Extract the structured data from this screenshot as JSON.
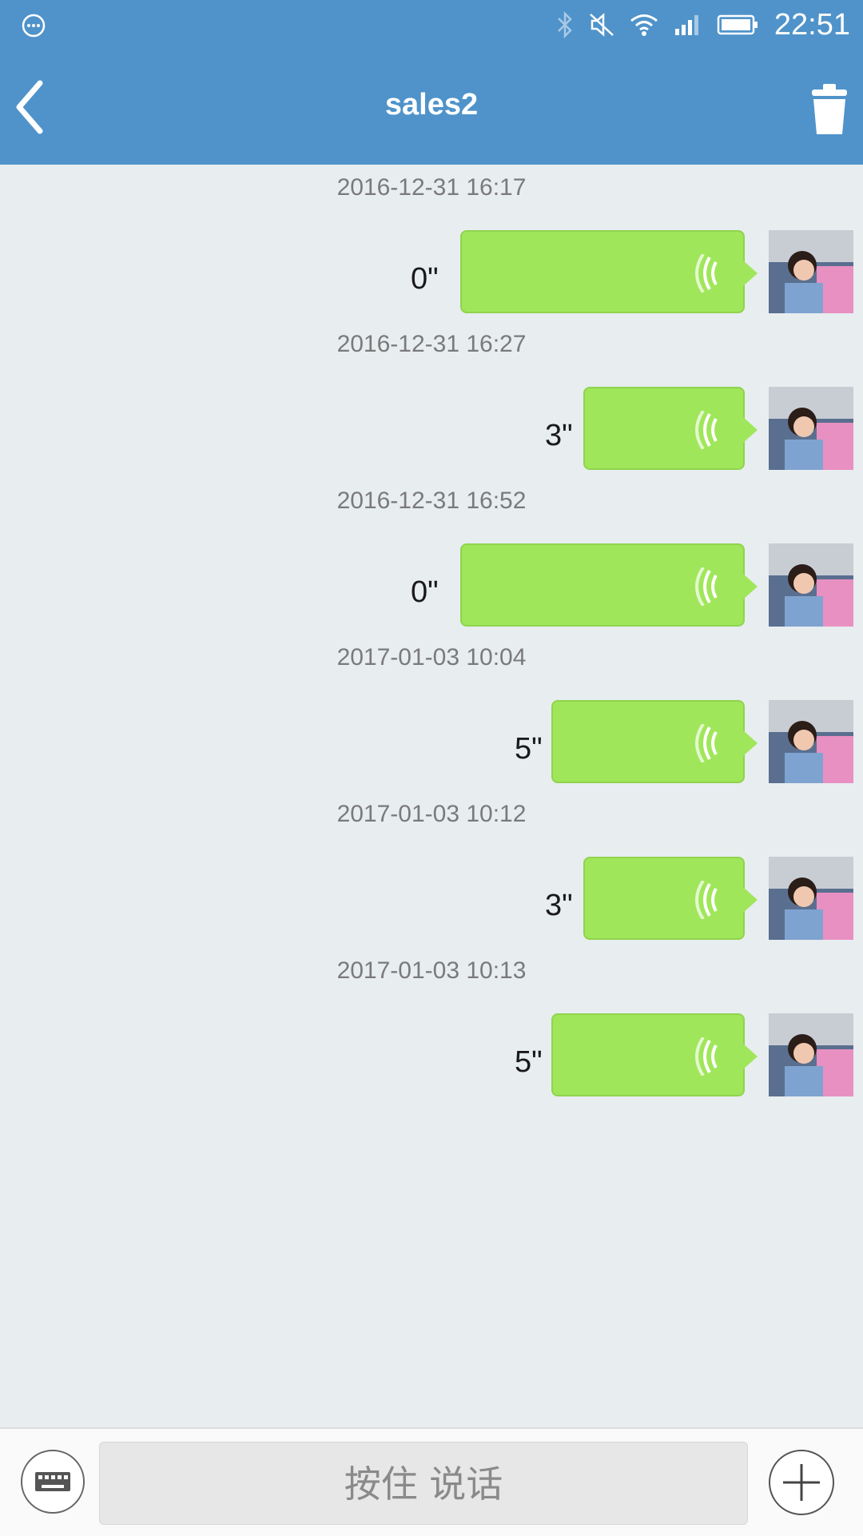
{
  "status_bar": {
    "time": "22:51"
  },
  "header": {
    "title": "sales2"
  },
  "messages": [
    {
      "timestamp": "2016-12-31 16:17",
      "duration": "0\""
    },
    {
      "timestamp": "2016-12-31 16:27",
      "duration": "3\""
    },
    {
      "timestamp": "2016-12-31 16:52",
      "duration": "0\""
    },
    {
      "timestamp": "2017-01-03 10:04",
      "duration": "5\""
    },
    {
      "timestamp": "2017-01-03 10:12",
      "duration": "3\""
    },
    {
      "timestamp": "2017-01-03 10:13",
      "duration": "5\""
    }
  ],
  "input_bar": {
    "hold_to_talk": "按住 说话"
  },
  "colors": {
    "header_bg": "#4f93ca",
    "chat_bg": "#e8edf0",
    "bubble": "#a0e65a"
  },
  "icons": {
    "status_left": "chat-bubble-icon",
    "status_right": [
      "bluetooth-icon",
      "mute-icon",
      "wifi-icon",
      "signal-icon",
      "battery-icon"
    ],
    "header_left": "back-arrow-icon",
    "header_right": "trash-icon",
    "bubble": "voice-wave-icon",
    "input_left": "keyboard-icon",
    "input_right": "plus-icon"
  }
}
